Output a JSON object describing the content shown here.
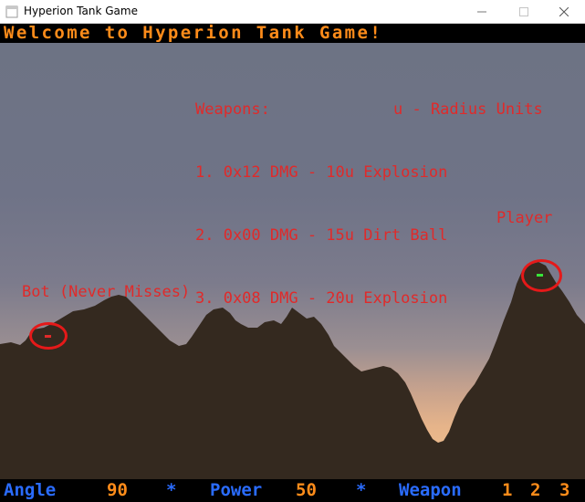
{
  "window": {
    "title": "Hyperion Tank Game"
  },
  "banner": {
    "text": "Welcome to Hyperion Tank Game!"
  },
  "weapons_panel": {
    "header_left": "Weapons:",
    "header_right": "u - Radius Units",
    "items": [
      {
        "text": "1. 0x12 DMG - 10u Explosion"
      },
      {
        "text": "2. 0x00 DMG - 15u Dirt Ball"
      },
      {
        "text": "3. 0x08 DMG - 20u Explosion"
      }
    ]
  },
  "labels": {
    "player": "Player",
    "bot": "Bot (Never Misses)"
  },
  "status": {
    "angle_label": "Angle",
    "angle_value": "90",
    "power_label": "Power",
    "power_value": "50",
    "weapon_label": "Weapon",
    "weapon_options": [
      "1",
      "2",
      "3"
    ],
    "separator": "*"
  },
  "colors": {
    "banner_text": "#ff8c1a",
    "overlay_text": "#e02a2a",
    "status_label": "#2a6cff",
    "status_value": "#ff8c1a",
    "player_tank": "#39e639",
    "bot_tank": "#e02a2a",
    "highlight_ring": "#e51919",
    "terrain": "#34291f"
  },
  "icons": {
    "app": "app-icon",
    "minimize": "minimize-icon",
    "maximize": "maximize-icon",
    "close": "close-icon"
  }
}
